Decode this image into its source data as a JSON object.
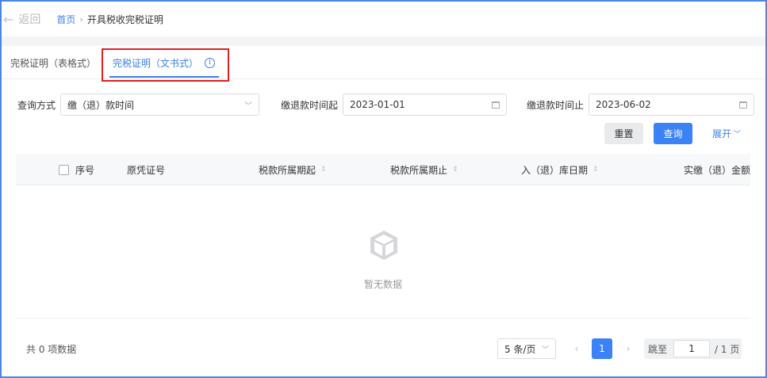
{
  "header": {
    "back_label": "返回",
    "breadcrumb_home": "首页",
    "breadcrumb_sep": "›",
    "breadcrumb_current": "开具税收完税证明"
  },
  "tabs": [
    {
      "label": "完税证明（表格式）",
      "active": false
    },
    {
      "label": "完税证明（文书式）",
      "active": true
    }
  ],
  "filters": {
    "query_method_label": "查询方式",
    "query_method_value": "缴（退）款时间",
    "start_label": "缴退款时间起",
    "start_value": "2023-01-01",
    "end_label": "缴退款时间止",
    "end_value": "2023-06-02"
  },
  "actions": {
    "reset_label": "重置",
    "query_label": "查询",
    "expand_label": "展开"
  },
  "table": {
    "columns": [
      "序号",
      "原凭证号",
      "税款所属期起",
      "税款所属期止",
      "入（退）库日期",
      "实缴（退）金额"
    ],
    "empty_text": "暂无数据"
  },
  "pagination": {
    "total_text": "共 0 项数据",
    "page_size": "5 条/页",
    "current_page": "1",
    "jump_label": "跳至",
    "jump_value": "1",
    "page_total": "/ 1 页"
  },
  "colors": {
    "accent": "#3b82f6",
    "highlight_box": "#e02020"
  }
}
